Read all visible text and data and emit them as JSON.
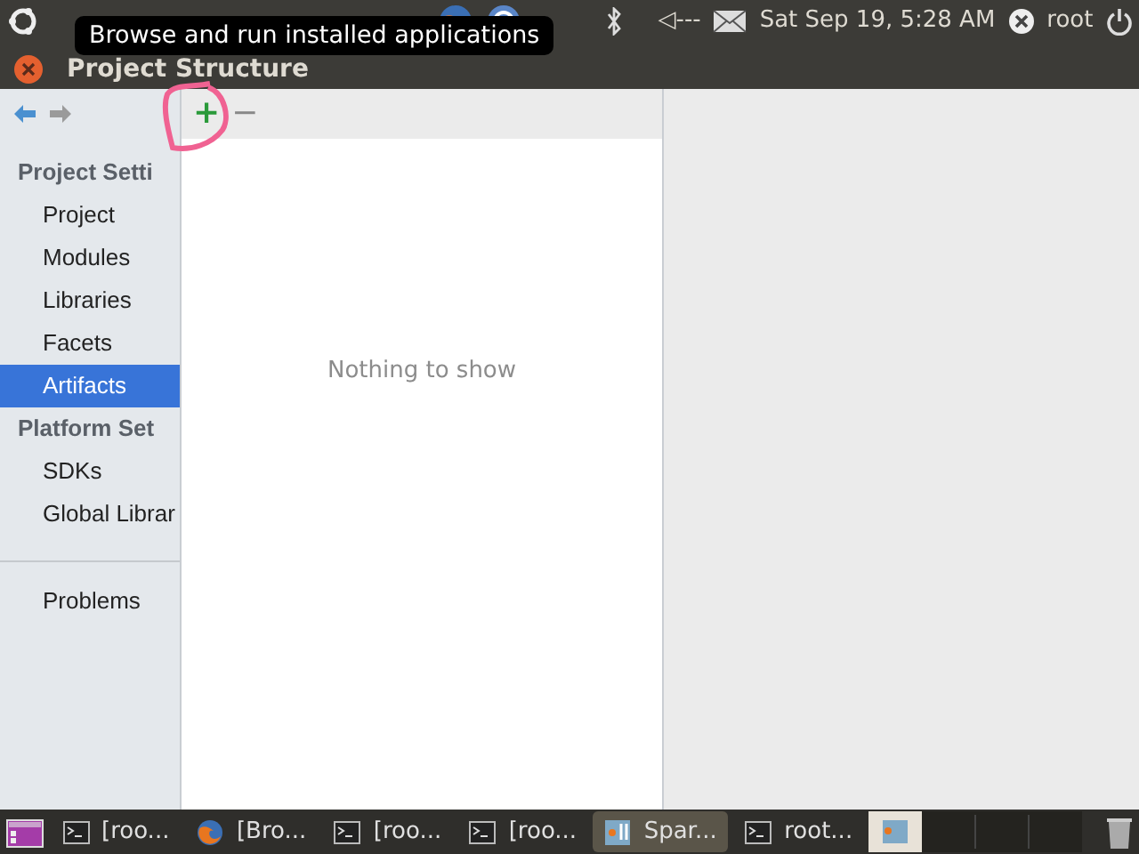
{
  "top_panel": {
    "clock": "Sat Sep 19,  5:28 AM",
    "volume": "◁---",
    "user": "root"
  },
  "tooltip": "Browse and run installed applications",
  "window": {
    "title": "Project Structure"
  },
  "sidebar": {
    "groups": [
      {
        "heading": "Project Setti",
        "items": [
          {
            "label": "Project",
            "selected": false
          },
          {
            "label": "Modules",
            "selected": false
          },
          {
            "label": "Libraries",
            "selected": false
          },
          {
            "label": "Facets",
            "selected": false
          },
          {
            "label": "Artifacts",
            "selected": true
          }
        ]
      },
      {
        "heading": "Platform Set",
        "items": [
          {
            "label": "SDKs",
            "selected": false
          },
          {
            "label": "Global Librar",
            "selected": false
          }
        ]
      }
    ],
    "footer_items": [
      {
        "label": "Problems",
        "selected": false
      }
    ]
  },
  "list_toolbar": {
    "add": "+",
    "remove": "−"
  },
  "empty_text": "Nothing to show",
  "taskbar": {
    "tasks": [
      {
        "label": "[roo...",
        "kind": "terminal",
        "selected": false
      },
      {
        "label": "[Bro...",
        "kind": "browser",
        "selected": false
      },
      {
        "label": "[roo...",
        "kind": "terminal",
        "selected": false
      },
      {
        "label": "[roo...",
        "kind": "terminal",
        "selected": false
      },
      {
        "label": "Spar...",
        "kind": "ide",
        "selected": true
      },
      {
        "label": "root...",
        "kind": "terminal",
        "selected": false
      }
    ]
  }
}
